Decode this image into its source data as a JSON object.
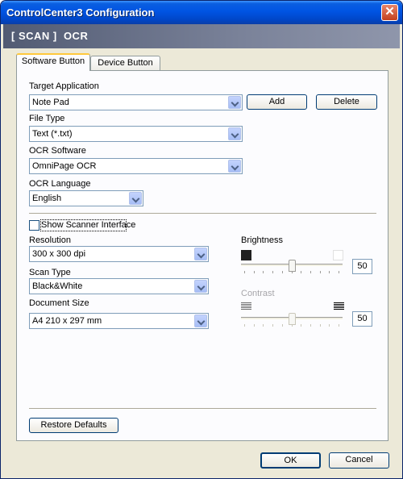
{
  "window": {
    "title": "ControlCenter3 Configuration",
    "close_glyph": "✕"
  },
  "header": {
    "text": "[ SCAN ]  OCR"
  },
  "tabs": [
    {
      "label": "Software Button",
      "active": true
    },
    {
      "label": "Device Button",
      "active": false
    }
  ],
  "target_application": {
    "label": "Target Application",
    "value": "Note Pad",
    "add_label": "Add",
    "delete_label": "Delete"
  },
  "file_type": {
    "label": "File Type",
    "value": "Text (*.txt)"
  },
  "ocr_software": {
    "label": "OCR Software",
    "value": "OmniPage OCR"
  },
  "ocr_language": {
    "label": "OCR Language",
    "value": "English"
  },
  "show_scanner": {
    "label": "Show Scanner Interface",
    "checked": false
  },
  "resolution": {
    "label": "Resolution",
    "value": "300 x 300 dpi"
  },
  "scan_type": {
    "label": "Scan Type",
    "value": "Black&White"
  },
  "document_size": {
    "label": "Document Size",
    "value": "A4 210 x 297 mm"
  },
  "brightness": {
    "label": "Brightness",
    "value": "50",
    "level": 0.5,
    "enabled": true
  },
  "contrast": {
    "label": "Contrast",
    "value": "50",
    "level": 0.5,
    "enabled": false
  },
  "restore_defaults_label": "Restore Defaults",
  "footer": {
    "ok_label": "OK",
    "cancel_label": "Cancel"
  },
  "colors": {
    "titlebar": "#0054e3",
    "header_bar": "#6c7489",
    "dialog_bg": "#ece9d8",
    "tab_highlight": "#ffc83c"
  }
}
